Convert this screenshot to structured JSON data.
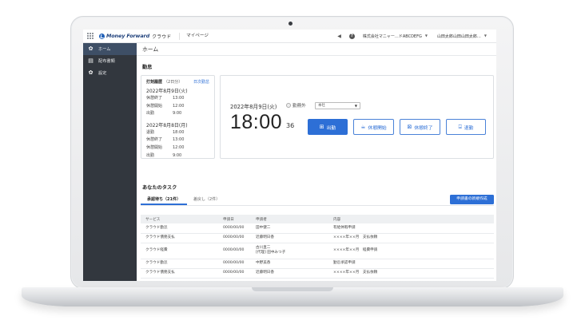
{
  "topbar": {
    "logo_text": "Money Forward",
    "logo_sub": "クラウド",
    "mypage": "マイページ",
    "company": "株式会社マニャー…ドABCDEFG",
    "user": "山田太郎山田山田太郎…",
    "icons": [
      "apps-grid-icon",
      "notification-icon",
      "help-icon"
    ]
  },
  "sidebar": {
    "items": [
      {
        "label": "ホーム",
        "icon": "gear-icon",
        "active": true
      },
      {
        "label": "配布書類",
        "icon": "document-icon",
        "active": false
      },
      {
        "label": "設定",
        "icon": "gear-icon",
        "active": false
      }
    ]
  },
  "main": {
    "page_title": "ホーム",
    "attendance_title": "勤怠",
    "history": {
      "title": "打刻履歴",
      "count": "（2日分）",
      "link": "日次勤怠",
      "days": [
        {
          "date": "2022年8月9日(火)",
          "rows": [
            {
              "label": "休憩終了",
              "time": "13:00"
            },
            {
              "label": "休憩開始",
              "time": "12:00"
            },
            {
              "label": "出勤",
              "time": "9:00"
            }
          ]
        },
        {
          "date": "2022年8月8日(月)",
          "rows": [
            {
              "label": "退勤",
              "time": "18:00"
            },
            {
              "label": "休憩終了",
              "time": "13:00"
            },
            {
              "label": "休憩開始",
              "time": "12:00"
            },
            {
              "label": "出勤",
              "time": "9:00"
            }
          ]
        }
      ]
    },
    "punch": {
      "date": "2022年8月9日(火)",
      "radio_label": "勤務外",
      "select_value": "本社",
      "time": "18:00",
      "seconds": "36",
      "buttons": {
        "clock_in": "出勤",
        "break_start": "休憩開始",
        "break_end": "休憩終了",
        "clock_out": "退勤"
      }
    },
    "tasks_title": "あなたのタスク",
    "tabs": [
      "承認待ち（21件）",
      "差戻し（2件）"
    ],
    "create_button": "申請書の新規作成",
    "table": {
      "headers": [
        "サービス",
        "申請日",
        "申請者",
        "内容"
      ],
      "rows": [
        {
          "service": "クラウド勤怠",
          "date": "0000/00/00",
          "applicant": "田中健二",
          "applicant2": "",
          "content": "有給休暇申請"
        },
        {
          "service": "クラウド債務支払",
          "date": "0000/00/00",
          "applicant": "近藤明日香",
          "applicant2": "",
          "content": "××××年××月　支払依頼"
        },
        {
          "service": "クラウド経費",
          "date": "0000/00/00",
          "applicant": "古川直二",
          "applicant2": "[代理] 田中みつ子",
          "content": "××××年××月　経費申請"
        },
        {
          "service": "クラウド勤怠",
          "date": "0000/00/00",
          "applicant": "中野美香",
          "applicant2": "",
          "content": "勤怠承認申請"
        },
        {
          "service": "クラウド債務支払",
          "date": "0000/00/00",
          "applicant": "近藤明日香",
          "applicant2": "",
          "content": "××××年××月　支払依頼"
        }
      ]
    }
  },
  "colors": {
    "accent": "#2d6fd6",
    "sidebar_bg": "#32373e",
    "sidebar_active": "#3e4f66"
  }
}
